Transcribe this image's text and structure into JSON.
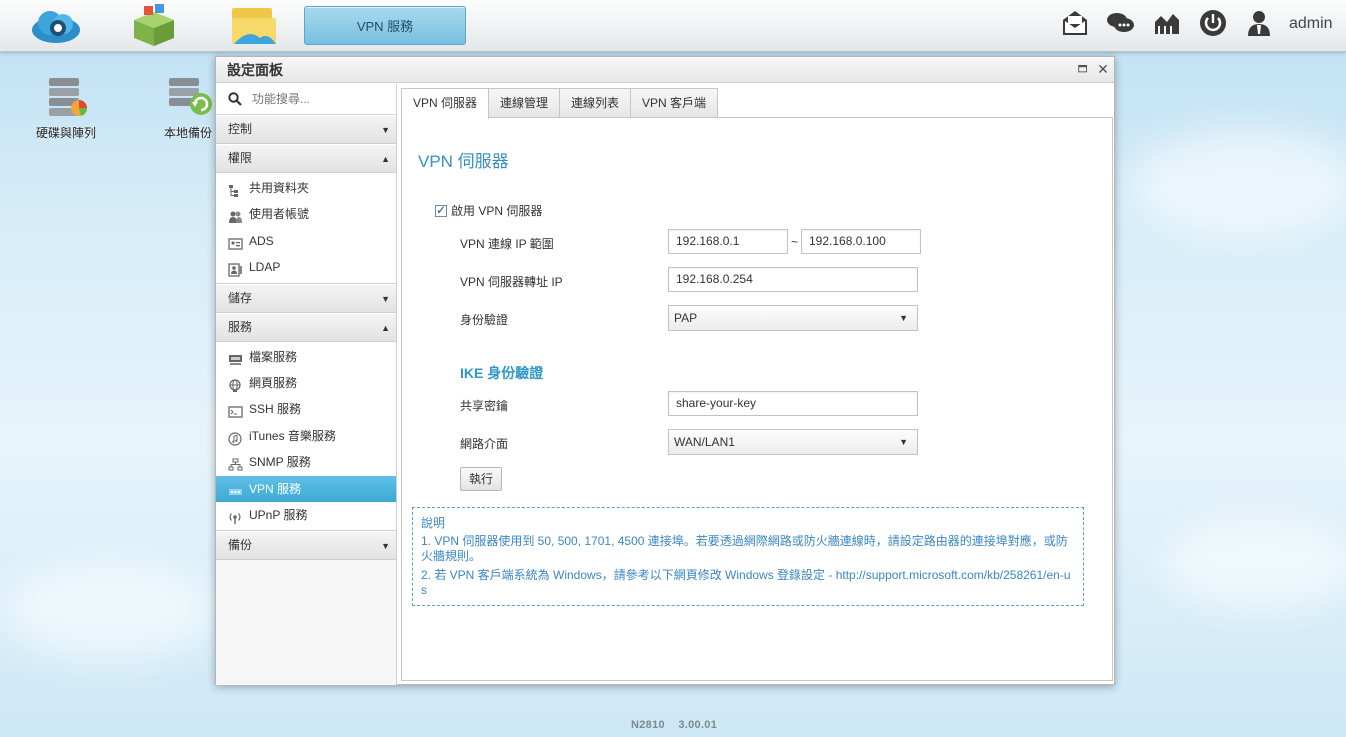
{
  "taskbar": {
    "active_tab": "VPN 服務",
    "user": "admin",
    "apps": [
      "cloud-app-icon",
      "package-app-icon",
      "file-manager-icon"
    ],
    "right_icons": [
      "mail-icon",
      "chat-icon",
      "network-icon",
      "power-icon",
      "user-icon"
    ]
  },
  "desktop": {
    "icons": [
      {
        "label": "硬碟與陣列",
        "icon": "disk-array-icon"
      },
      {
        "label": "本地備份",
        "icon": "local-backup-icon"
      }
    ]
  },
  "window": {
    "title": "設定面板"
  },
  "sidebar": {
    "search_placeholder": "功能搜尋...",
    "categories": [
      {
        "label": "控制",
        "expanded": false,
        "items": []
      },
      {
        "label": "權限",
        "expanded": true,
        "items": [
          {
            "label": "共用資料夾",
            "icon": "folder-tree-icon"
          },
          {
            "label": "使用者帳號",
            "icon": "users-icon"
          },
          {
            "label": "ADS",
            "icon": "ads-icon"
          },
          {
            "label": "LDAP",
            "icon": "ldap-icon"
          }
        ]
      },
      {
        "label": "儲存",
        "expanded": false,
        "items": []
      },
      {
        "label": "服務",
        "expanded": true,
        "items": [
          {
            "label": "檔案服務",
            "icon": "file-service-icon"
          },
          {
            "label": "網頁服務",
            "icon": "globe-icon"
          },
          {
            "label": "SSH 服務",
            "icon": "terminal-icon"
          },
          {
            "label": "iTunes 音樂服務",
            "icon": "music-icon"
          },
          {
            "label": "SNMP 服務",
            "icon": "snmp-icon"
          },
          {
            "label": "VPN 服務",
            "icon": "vpn-icon",
            "active": true
          },
          {
            "label": "UPnP 服務",
            "icon": "upnp-icon"
          }
        ]
      },
      {
        "label": "備份",
        "expanded": false,
        "items": []
      }
    ]
  },
  "tabs": [
    "VPN 伺服器",
    "連線管理",
    "連線列表",
    "VPN 客戶端"
  ],
  "form": {
    "title": "VPN 伺服器",
    "enable_label": "啟用 VPN 伺服器",
    "enable_checked": true,
    "ip_range_label": "VPN 連線 IP 範圍",
    "ip_range_start": "192.168.0.1",
    "ip_range_sep": "~",
    "ip_range_end": "192.168.0.100",
    "forward_ip_label": "VPN 伺服器轉址 IP",
    "forward_ip": "192.168.0.254",
    "auth_label": "身份驗證",
    "auth_value": "PAP",
    "ike_title": "IKE 身份驗證",
    "psk_label": "共享密鑰",
    "psk_value": "share-your-key",
    "iface_label": "網路介面",
    "iface_value": "WAN/LAN1",
    "apply_label": "執行"
  },
  "note": {
    "title": "說明",
    "line1": "1. VPN 伺服器使用到 50, 500, 1701, 4500 連接埠。若要透過網際網路或防火牆連線時，請設定路由器的連接埠對應，或防火牆規則。",
    "line2": "2. 若 VPN 客戶端系統為 Windows，請參考以下網頁修改 Windows 登錄設定 - http://support.microsoft.com/kb/258261/en-us"
  },
  "footer": {
    "version": "N2810    3.00.01"
  }
}
